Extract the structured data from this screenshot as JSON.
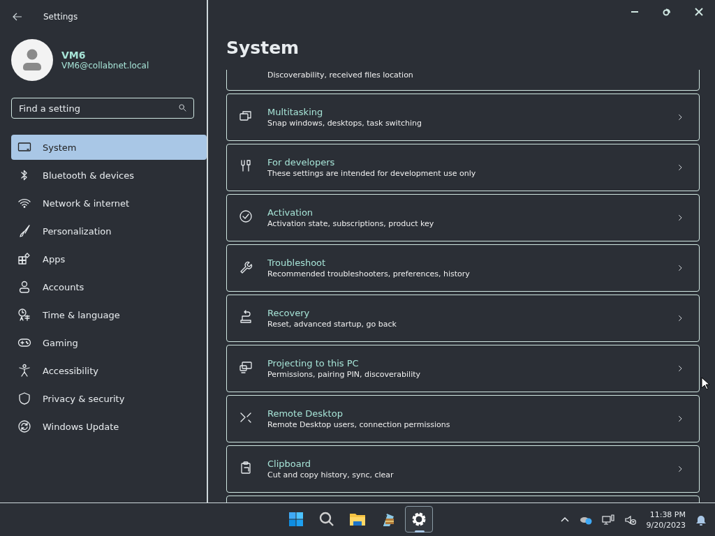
{
  "window": {
    "title": "Settings"
  },
  "profile": {
    "name": "VM6",
    "email": "VM6@collabnet.local"
  },
  "search": {
    "placeholder": "Find a setting"
  },
  "nav": [
    {
      "label": "System",
      "selected": true
    },
    {
      "label": "Bluetooth & devices",
      "selected": false
    },
    {
      "label": "Network & internet",
      "selected": false
    },
    {
      "label": "Personalization",
      "selected": false
    },
    {
      "label": "Apps",
      "selected": false
    },
    {
      "label": "Accounts",
      "selected": false
    },
    {
      "label": "Time & language",
      "selected": false
    },
    {
      "label": "Gaming",
      "selected": false
    },
    {
      "label": "Accessibility",
      "selected": false
    },
    {
      "label": "Privacy & security",
      "selected": false
    },
    {
      "label": "Windows Update",
      "selected": false
    }
  ],
  "page_title": "System",
  "cards": [
    {
      "subtitle": "Discoverability, received files location"
    },
    {
      "title": "Multitasking",
      "subtitle": "Snap windows, desktops, task switching"
    },
    {
      "title": "For developers",
      "subtitle": "These settings are intended for development use only"
    },
    {
      "title": "Activation",
      "subtitle": "Activation state, subscriptions, product key"
    },
    {
      "title": "Troubleshoot",
      "subtitle": "Recommended troubleshooters, preferences, history"
    },
    {
      "title": "Recovery",
      "subtitle": "Reset, advanced startup, go back"
    },
    {
      "title": "Projecting to this PC",
      "subtitle": "Permissions, pairing PIN, discoverability"
    },
    {
      "title": "Remote Desktop",
      "subtitle": "Remote Desktop users, connection permissions"
    },
    {
      "title": "Clipboard",
      "subtitle": "Cut and copy history, sync, clear"
    }
  ],
  "taskbar": {
    "apps": [
      {
        "selected": false
      },
      {
        "selected": false
      },
      {
        "selected": false
      },
      {
        "selected": false
      },
      {
        "selected": true
      }
    ],
    "time": "11:38 PM",
    "date": "9/20/2023"
  }
}
